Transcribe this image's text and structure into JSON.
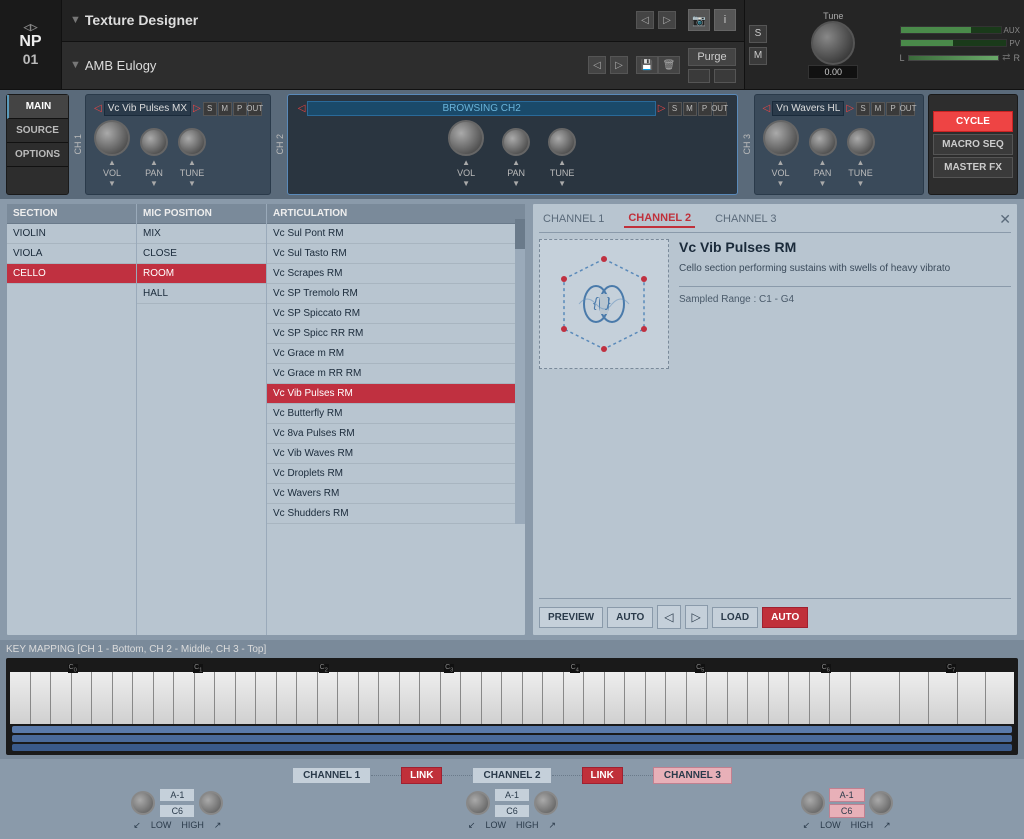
{
  "header": {
    "logo": {
      "line1": "NP",
      "line2": "01"
    },
    "plugin_name": "Texture Designer",
    "preset_name": "AMB Eulogy",
    "purge_label": "Purge",
    "tune_label": "Tune",
    "tune_value": "0.00",
    "s_btn": "S",
    "m_btn": "M"
  },
  "tabs": {
    "left": [
      {
        "label": "MAIN",
        "active": true
      },
      {
        "label": "SOURCE",
        "active": false
      },
      {
        "label": "OPTIONS",
        "active": false
      }
    ],
    "right": [
      {
        "label": "CYCLE",
        "active": true
      },
      {
        "label": "MACRO SEQ",
        "active": false
      },
      {
        "label": "MASTER FX",
        "active": false
      }
    ]
  },
  "channels": {
    "ch1": {
      "number": "CH 1",
      "name": "Vc Vib Pulses MX",
      "vol_label": "VOL",
      "pan_label": "PAN",
      "tune_label": "TUNE"
    },
    "ch2": {
      "number": "CH 2",
      "name": "BROWSING CH2",
      "vol_label": "VOL",
      "pan_label": "PAN",
      "tune_label": "TUNE",
      "active": true
    },
    "ch3": {
      "number": "CH 3",
      "name": "Vn Wavers HL",
      "vol_label": "VOL",
      "pan_label": "PAN",
      "tune_label": "TUNE"
    }
  },
  "smpo_buttons": [
    "S",
    "M",
    "P",
    "OUT"
  ],
  "browser": {
    "columns": [
      {
        "header": "SECTION",
        "items": [
          {
            "label": "VIOLIN",
            "selected": false
          },
          {
            "label": "VIOLA",
            "selected": false
          },
          {
            "label": "CELLO",
            "selected": true
          }
        ]
      },
      {
        "header": "MIC POSITION",
        "items": [
          {
            "label": "MIX",
            "selected": false
          },
          {
            "label": "CLOSE",
            "selected": false
          },
          {
            "label": "ROOM",
            "selected": true
          },
          {
            "label": "HALL",
            "selected": false
          }
        ]
      },
      {
        "header": "ARTICULATION",
        "items": [
          {
            "label": "Vc Sul Pont RM"
          },
          {
            "label": "Vc Sul Tasto RM"
          },
          {
            "label": "Vc Scrapes RM"
          },
          {
            "label": "Vc SP Tremolo RM"
          },
          {
            "label": "Vc SP Spiccato RM"
          },
          {
            "label": "Vc SP Spicc RR RM"
          },
          {
            "label": "Vc Grace m RM"
          },
          {
            "label": "Vc Grace m RR RM"
          },
          {
            "label": "Vc Vib Pulses RM",
            "selected": true
          },
          {
            "label": "Vc Butterfly RM"
          },
          {
            "label": "Vc 8va Pulses RM"
          },
          {
            "label": "Vc Vib Waves RM"
          },
          {
            "label": "Vc Droplets RM"
          },
          {
            "label": "Vc Wavers RM"
          },
          {
            "label": "Vc Shudders RM"
          }
        ]
      }
    ]
  },
  "channel_tabs": [
    {
      "label": "CHANNEL 1",
      "active": false
    },
    {
      "label": "CHANNEL 2",
      "active": true
    },
    {
      "label": "CHANNEL 3",
      "active": false
    }
  ],
  "detail": {
    "instrument_name": "Vc Vib Pulses RM",
    "description": "Cello section performing sustains with swells of heavy vibrato",
    "sampled_range": "Sampled Range : C1 - G4",
    "buttons": {
      "preview": "PREVIEW",
      "auto": "AUTO",
      "load": "LOAD",
      "auto2": "AUTO"
    }
  },
  "key_mapping": {
    "title": "KEY MAPPING  [CH 1 - Bottom, CH 2 - Middle, CH 3 - Top]",
    "octave_labels": [
      "C0",
      "C1",
      "C2",
      "C3",
      "C4",
      "C5",
      "C6",
      "C7"
    ]
  },
  "bottom_channels": [
    {
      "label": "CHANNEL 1",
      "link": "LINK",
      "low": "A-1",
      "high": "C6",
      "low_label": "LOW",
      "high_label": "HIGH"
    },
    {
      "label": "CHANNEL 2",
      "link": "LINK",
      "low": "A-1",
      "high": "C6",
      "low_label": "LOW",
      "high_label": "HIGH"
    },
    {
      "label": "CHANNEL 3",
      "link": null,
      "low": "A-1",
      "high": "C6",
      "low_label": "LOW",
      "high_label": "HIGH",
      "pink": true
    }
  ]
}
